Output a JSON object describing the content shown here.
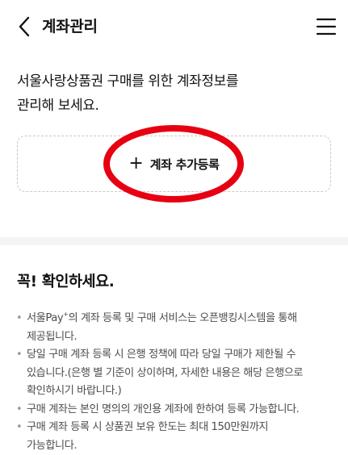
{
  "header": {
    "title": "계좌관리",
    "back_icon": "chevron-left-icon",
    "menu_icon": "hamburger-menu-icon"
  },
  "intro": {
    "line1": "서울사랑상품권 구매를 위한 계좌정보를",
    "line2": "관리해 보세요."
  },
  "add_account": {
    "icon": "plus-icon",
    "label": "계좌 추가등록",
    "highlight_color": "#e60012"
  },
  "notice": {
    "title": "꼭! 확인하세요.",
    "items": [
      {
        "line1_pre": "서울Pay",
        "line1_sup": "+",
        "line1_post": "의 계좌 등록 및 구매 서비스는 오픈뱅킹시스템을 통해",
        "line2": "제공됩니다."
      },
      {
        "line1": "당일 구매 계좌 등록 시 은행 정책에 따라 당일 구매가 제한될 수",
        "line2": "있습니다.(은행 별 기준이 상이하며, 자세한 내용은 해당 은행으로",
        "line3": "확인하시기 바랍니다.)"
      },
      {
        "line1": "구매 계좌는 본인 명의의 개인용 계좌에 한하여 등록 가능합니다."
      },
      {
        "line1": "구매 계좌 등록 시 상품권 보유 한도는 최대 150만원까지",
        "line2": "가능합니다."
      }
    ]
  }
}
